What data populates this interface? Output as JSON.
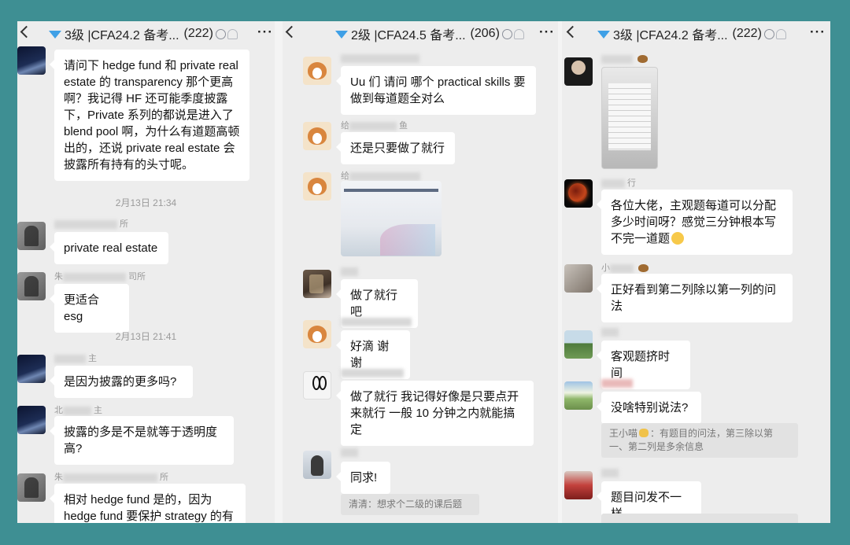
{
  "panels": [
    {
      "header": {
        "title": "3级 |CFA24.2 备考...",
        "count": "(222)"
      },
      "timestamps": [
        "2月13日 21:34",
        "2月13日 21:41"
      ],
      "names": [
        "所",
        "朱",
        "司所",
        "主",
        "北",
        "主",
        "朱",
        "所"
      ],
      "messages": [
        "请问下 hedge fund 和 private real estate 的 transparency 那个更高啊？我记得 HF 还可能季度披露下，Private 系列的都说是进入了 blend pool 啊，为什么有道题高顿出的，还说 private real estate 会披露所有持有的头寸呢。",
        "private real estate",
        "更适合 esg",
        "是因为披露的更多吗?",
        "披露的多是不是就等于透明度高?",
        "相对 hedge fund 是的，因为 hedge fund 要保护 strategy 的有"
      ]
    },
    {
      "header": {
        "title": "2级 |CFA24.5 备考...",
        "count": "(206)"
      },
      "names": [
        "给",
        "鱼",
        "给"
      ],
      "messages": [
        "Uu 们 请问 哪个 practical skills 要做到每道题全对么",
        "还是只要做了就行",
        "做了就行吧",
        "好滴 谢谢",
        "做了就行 我记得好像是只要点开来就行 一般 10 分钟之内就能搞定",
        "同求!"
      ],
      "quote": "清清：想求个二级的课后题"
    },
    {
      "header": {
        "title": "3级 |CFA24.2 备考...",
        "count": "(222)"
      },
      "names": [
        "行",
        "小"
      ],
      "messages": [
        "各位大佬，主观题每道可以分配多少时间呀？感觉三分钟根本写不完一道题",
        "正好看到第二列除以第一列的问法",
        "客观题挤时间",
        "没啥特别说法?",
        "题目问发不一样"
      ],
      "quote": {
        "name": "王小喵",
        "text": "：有题目的问法，第三除以第一、第二列是多余信息"
      }
    }
  ]
}
